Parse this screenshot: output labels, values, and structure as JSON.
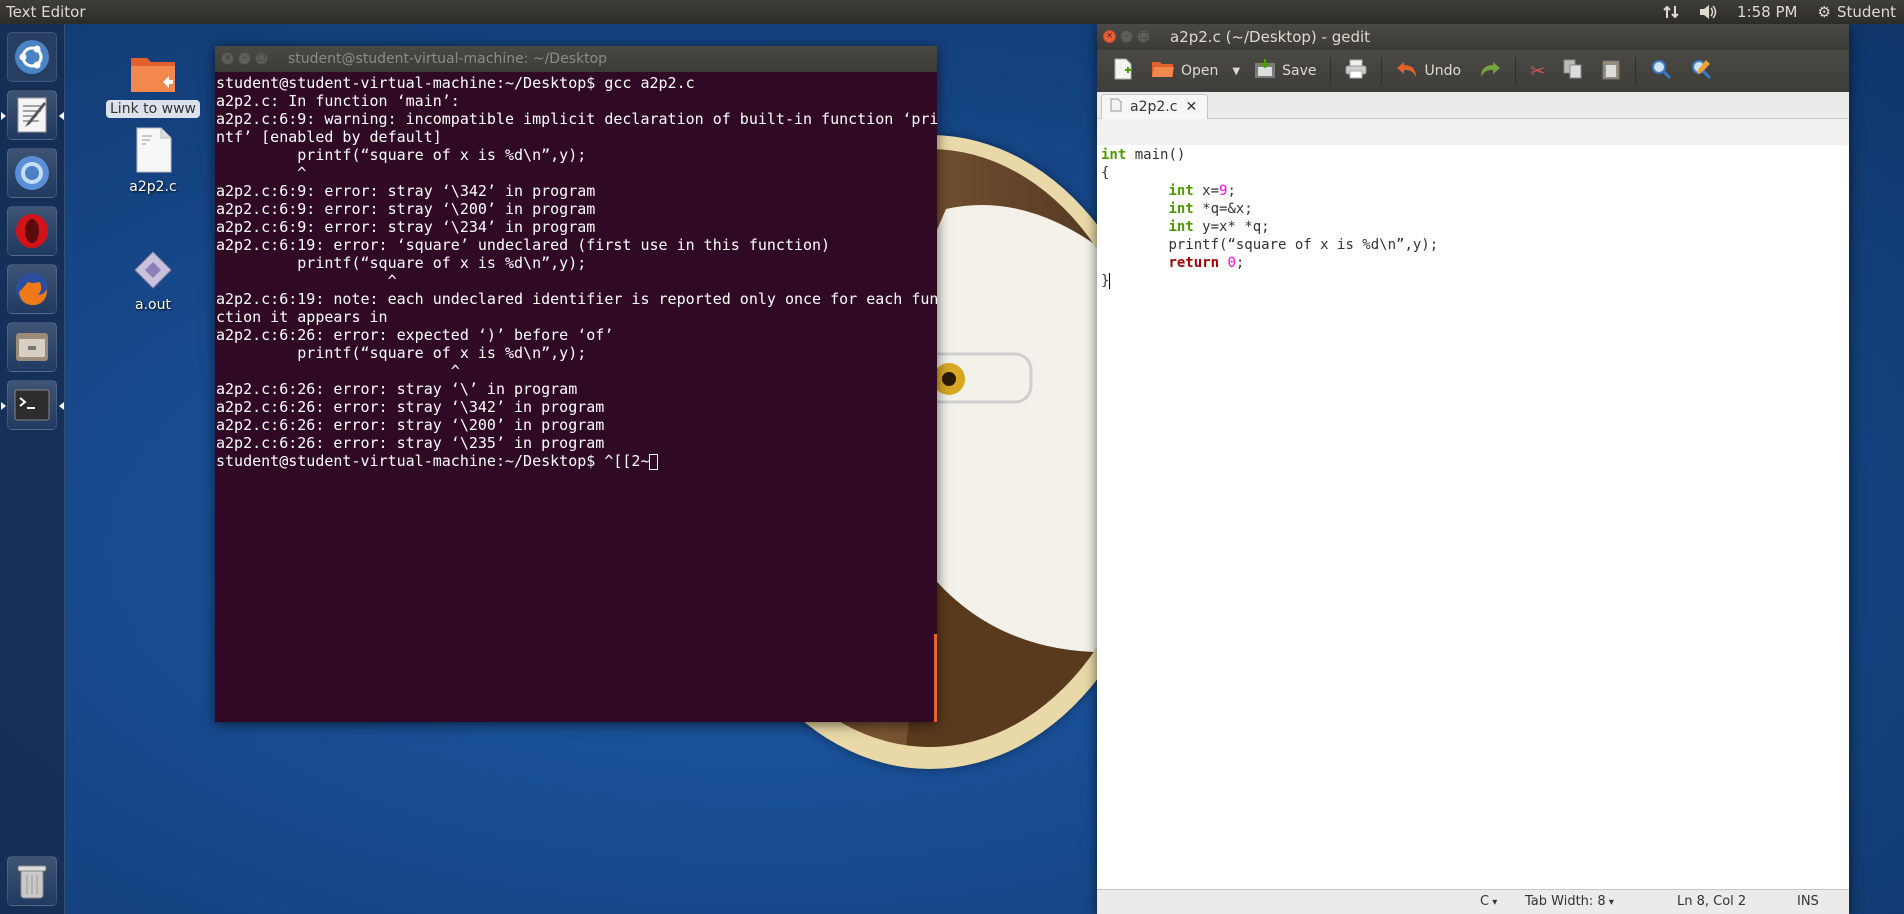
{
  "top_panel": {
    "app_title": "Text Editor",
    "time": "1:58 PM",
    "user": "Student",
    "icons": [
      "network-icon",
      "volume-icon",
      "gear-icon"
    ]
  },
  "launcher": {
    "items": [
      "ubuntu-dash-icon",
      "text-editor-icon",
      "chromium-icon",
      "opera-icon",
      "firefox-icon",
      "files-icon",
      "terminal-icon",
      "trash-icon"
    ]
  },
  "desktop": {
    "icons": [
      {
        "label": "Link to www",
        "icon": "folder-link-icon"
      },
      {
        "label": "a2p2.c",
        "icon": "c-file-icon"
      },
      {
        "label": "a.out",
        "icon": "executable-icon"
      }
    ]
  },
  "terminal": {
    "title": "student@student-virtual-machine: ~/Desktop",
    "lines": [
      "student@student-virtual-machine:~/Desktop$ gcc a2p2.c",
      "a2p2.c: In function ‘main’:",
      "a2p2.c:6:9: warning: incompatible implicit declaration of built-in function ‘pri",
      "ntf’ [enabled by default]",
      "         printf(“square of x is %d\\n”,y);",
      "         ^",
      "a2p2.c:6:9: error: stray ‘\\342’ in program",
      "a2p2.c:6:9: error: stray ‘\\200’ in program",
      "a2p2.c:6:9: error: stray ‘\\234’ in program",
      "a2p2.c:6:19: error: ‘square’ undeclared (first use in this function)",
      "         printf(“square of x is %d\\n”,y);",
      "                   ^",
      "a2p2.c:6:19: note: each undeclared identifier is reported only once for each fun",
      "ction it appears in",
      "a2p2.c:6:26: error: expected ‘)’ before ‘of’",
      "         printf(“square of x is %d\\n”,y);",
      "                          ^",
      "a2p2.c:6:26: error: stray ‘\\’ in program",
      "a2p2.c:6:26: error: stray ‘\\342’ in program",
      "a2p2.c:6:26: error: stray ‘\\200’ in program",
      "a2p2.c:6:26: error: stray ‘\\235’ in program"
    ],
    "prompt": "student@student-virtual-machine:~/Desktop$ ",
    "input": "^[[2~"
  },
  "gedit": {
    "title": "a2p2.c (~/Desktop) - gedit",
    "toolbar": {
      "open_label": "Open",
      "save_label": "Save",
      "undo_label": "Undo"
    },
    "tab": {
      "label": "a2p2.c"
    },
    "code": {
      "l1_kw": "int",
      "l1_rest": " main()",
      "l2": "{",
      "l3_kw": "int",
      "l3_a": " x=",
      "l3_num": "9",
      "l3_b": ";",
      "l4_kw": "int",
      "l4_rest": " *q=&x;",
      "l5_kw": "int",
      "l5_rest": " y=x* *q;",
      "l6": "printf(“square of x is %d\\n”,y);",
      "l7_kw": "return",
      "l7_num": "0",
      "l7_b": ";",
      "l8": "}"
    },
    "status": {
      "language": "C",
      "tab_width": "Tab Width: 8",
      "position": "Ln 8, Col 2",
      "mode": "INS"
    }
  }
}
